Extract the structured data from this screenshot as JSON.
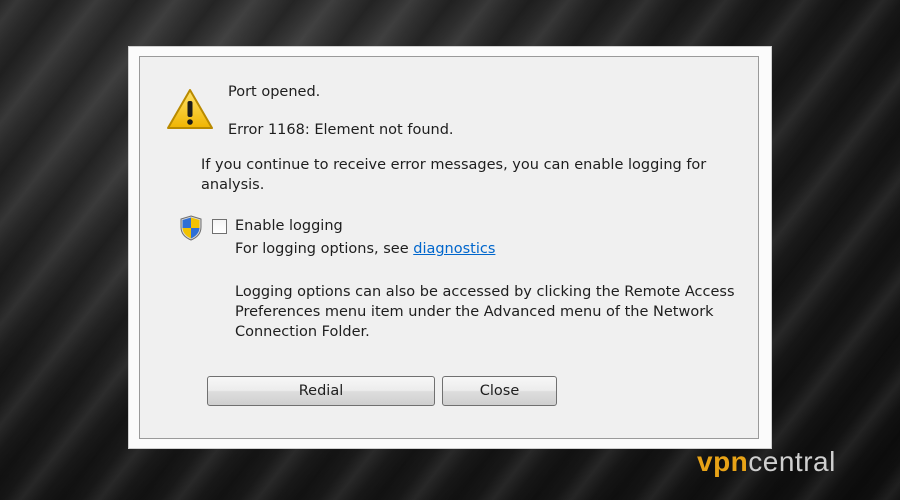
{
  "dialog": {
    "message_title": "Port opened.",
    "error_text": "Error 1168: Element not found.",
    "hint_line1": "If you continue to receive error messages, you can enable logging for",
    "hint_line2": "analysis.",
    "checkbox_label": "Enable logging",
    "checkbox_checked": false,
    "logging_options_prefix": "For logging options, see ",
    "diagnostics_link": "diagnostics",
    "info_line1": "Logging options can also be accessed by clicking the Remote Access",
    "info_line2": "Preferences menu item under the Advanced menu of the Network",
    "info_line3": "Connection Folder.",
    "buttons": {
      "redial": "Redial",
      "close": "Close"
    }
  },
  "watermark": {
    "part1": "vpn",
    "part2": "central"
  },
  "colors": {
    "link": "#0066cc",
    "warning_yellow": "#f5c400",
    "watermark_accent": "#e8a317"
  },
  "icons": {
    "warning": "warning-icon",
    "shield": "uac-shield-icon"
  }
}
